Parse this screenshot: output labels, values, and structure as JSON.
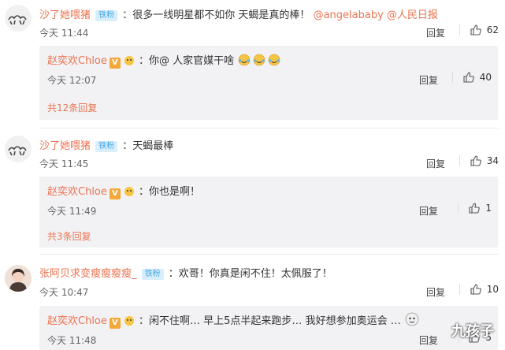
{
  "comments": [
    {
      "user": "沙了她喂猪",
      "badge": "铁粉",
      "text": "：很多一线明星都不如你 天蝎是真的棒！",
      "mentions": "@angelababy @人民日报",
      "time": "今天 11:44",
      "reply_label": "回复",
      "likes": "62",
      "reply": {
        "user": "赵奕欢Chloe",
        "text": "：你@ 人家官媒干啥",
        "time": "今天 12:07",
        "reply_label": "回复",
        "likes": "40"
      },
      "more": "共12条回复"
    },
    {
      "user": "沙了她喂猪",
      "badge": "铁粉",
      "text": "：天蝎最棒",
      "time": "今天 11:45",
      "reply_label": "回复",
      "likes": "34",
      "reply": {
        "user": "赵奕欢Chloe",
        "text": "：你也是啊！",
        "time": "今天 11:49",
        "reply_label": "回复",
        "likes": "1"
      },
      "more": "共3条回复"
    },
    {
      "user": "张阿贝求变瘦瘦瘦瘦_",
      "badge": "铁粉",
      "text": "：欢哥！你真是闲不住！太佩服了！",
      "time": "今天 10:47",
      "reply_label": "回复",
      "likes": "10",
      "reply": {
        "user": "赵奕欢Chloe",
        "text": "：闲不住啊… 早上5点半起来跑步… 我好想参加奥运会 …",
        "time": "今天 11:48",
        "reply_label": "回复",
        "likes": "5"
      }
    }
  ],
  "vip_letter": "V",
  "watermark": "九孩子",
  "colors": {
    "username": "#eb7350",
    "badge_bg": "#d8eefa",
    "badge_fg": "#46a7e6",
    "reply_box": "#f2f2f5"
  }
}
